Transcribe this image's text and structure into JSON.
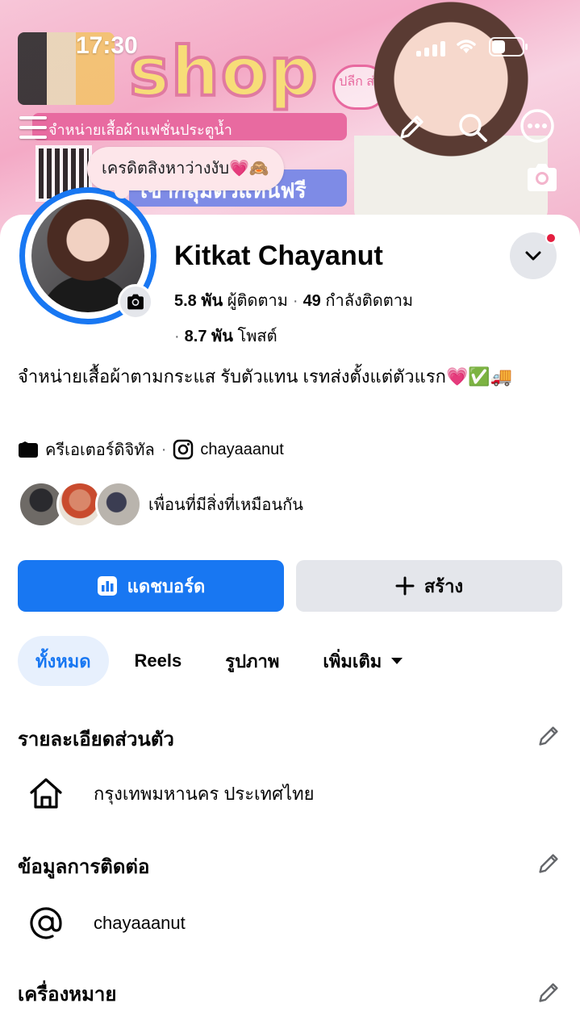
{
  "status_bar": {
    "time": "17:30"
  },
  "cover": {
    "title": "shop",
    "banner_line": "จำหน่ายเสื้อผ้าแฟชั่นประตูน้ำ",
    "banner_line2": "เข้ากลุ่มตัวแทนฟรี",
    "badge": "ปลีก ส่ง"
  },
  "note": {
    "text": "เครดิตสิงหาว่างงับ💗🙈"
  },
  "profile": {
    "name": "Kitkat Chayanut",
    "followers_count": "5.8 พัน",
    "followers_label": "ผู้ติดตาม",
    "following_count": "49",
    "following_label": "กำลังติดตาม",
    "posts_count": "8.7 พัน",
    "posts_label": "โพสต์",
    "bio": "จำหน่ายเสื้อผ้าตามกระแส รับตัวแทน เรทส่งตั้งแต่ตัวแรก💗✅🚚",
    "category": "ครีเอเตอร์ดิจิทัล",
    "instagram": "chayaaanut",
    "mutual_label": "เพื่อนที่มีสิ่งที่เหมือนกัน"
  },
  "actions": {
    "primary_label": "แดชบอร์ด",
    "secondary_label": "สร้าง"
  },
  "tabs": [
    {
      "label": "ทั้งหมด",
      "active": true
    },
    {
      "label": "Reels",
      "active": false
    },
    {
      "label": "รูปภาพ",
      "active": false
    },
    {
      "label": "เพิ่มเติม",
      "active": false
    }
  ],
  "sections": {
    "personal": {
      "title": "รายละเอียดส่วนตัว",
      "location": "กรุงเทพมหานคร ประเทศไทย"
    },
    "contact": {
      "title": "ข้อมูลการติดต่อ",
      "username": "chayaaanut"
    },
    "badges": {
      "title": "เครื่องหมาย"
    }
  },
  "colors": {
    "accent": "#1877f2",
    "tab_active_bg": "#e7f0fd",
    "secondary_btn": "#e4e6eb",
    "notify_dot": "#e41e3f"
  }
}
